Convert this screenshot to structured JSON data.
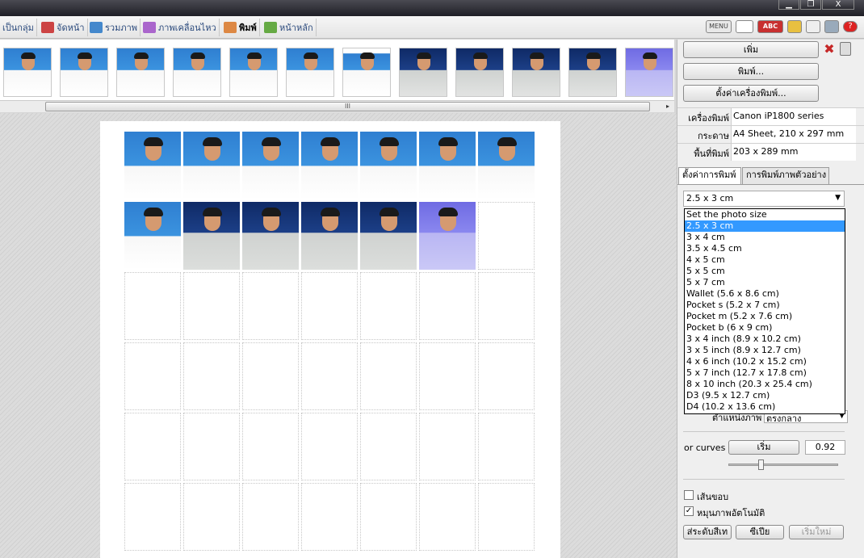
{
  "window": {
    "min_glyph": "▁",
    "max_glyph": "❐",
    "close_glyph": "X"
  },
  "nav_tabs": [
    {
      "label": "เป็นกลุ่ม",
      "icon": "group-icon",
      "color": "#7a9"
    },
    {
      "label": "จัดหน้า",
      "icon": "layout-icon",
      "color": "#c44"
    },
    {
      "label": "รวมภาพ",
      "icon": "merge-icon",
      "color": "#48c"
    },
    {
      "label": "ภาพเคลื่อนไหว",
      "icon": "animation-icon",
      "color": "#a6c"
    },
    {
      "label": "พิมพ์",
      "icon": "printer-icon",
      "color": "#d84"
    },
    {
      "label": "หน้าหลัก",
      "icon": "home-icon",
      "color": "#6a4"
    }
  ],
  "right_tools": {
    "menu": "MENU",
    "abc": "ABC",
    "help": "?"
  },
  "hscroll_grip": "III",
  "hscroll_right": "▸",
  "panel": {
    "add_label": "เพิ่ม",
    "print_label": "พิมพ์...",
    "printer_setup_label": "ตั้งค่าเครื่องพิมพ์...",
    "delete_glyph": "✖",
    "info": [
      {
        "label": "เครื่องพิมพ์",
        "value": "Canon iP1800 series"
      },
      {
        "label": "กระดาษ",
        "value": "A4 Sheet, 210 x 297 mm"
      },
      {
        "label": "พื้นที่พิมพ์",
        "value": "203 x 289 mm"
      }
    ],
    "tab_setup": "ตั้งค่าการพิมพ์",
    "tab_sample": "การพิมพ์ภาพตัวอย่าง",
    "size_selected": "2.5 x 3 cm",
    "size_arrow": "▼",
    "size_options": [
      "Set the photo size",
      "2.5 x 3 cm",
      "3 x 4 cm",
      "3.5 x 4.5 cm",
      "4 x 5 cm",
      "5 x 5 cm",
      "5 x 7 cm",
      "Wallet (5.6 x 8.6 cm)",
      "Pocket s (5.2 x 7 cm)",
      "Pocket m (5.2 x 7.6 cm)",
      "Pocket b (6 x 9 cm)",
      "3 x 4 inch (8.9 x 10.2 cm)",
      "3 x 5 inch (8.9 x 12.7 cm)",
      "4 x 6 inch (10.2 x 15.2 cm)",
      "5 x 7 inch (12.7 x 17.8 cm)",
      "8 x 10 inch (20.3 x 25.4 cm)",
      "D3 (9.5 x 12.7 cm)",
      "D4 (10.2 x 13.6 cm)"
    ],
    "position_label": "ตำแหน่งภาพ",
    "position_value": "ตรงกลาง",
    "curves_label": "or curves",
    "curves_button": "เริ่ม",
    "curves_value": "0.92",
    "border_label": "เส้นขอบ",
    "border_checked": false,
    "autorotate_label": "หมุนภาพอัตโนมัติ",
    "autorotate_checked": true,
    "check_glyph": "✓",
    "level_label": "ส่ระดับสีเท",
    "sepia_label": "ซีเปีย",
    "reset_label": "เริ่มใหม่"
  }
}
